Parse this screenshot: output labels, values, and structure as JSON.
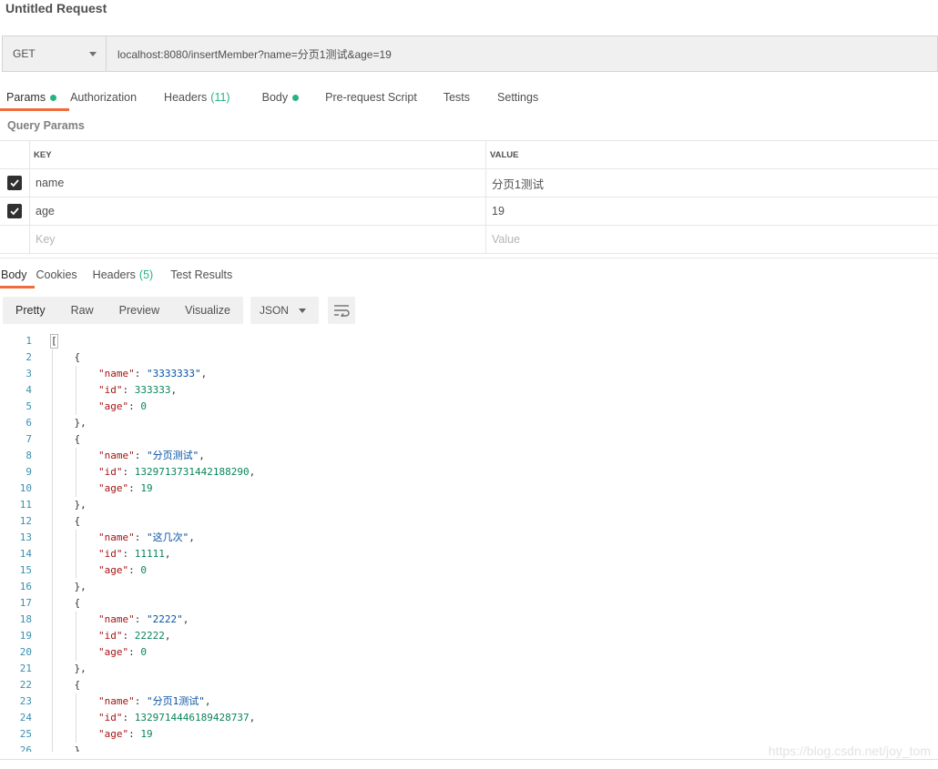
{
  "request": {
    "title": "Untitled Request",
    "method": "GET",
    "url": "localhost:8080/insertMember?name=分页1测试&age=19"
  },
  "request_tabs": [
    {
      "label": "Params",
      "dot": true,
      "active": true
    },
    {
      "label": "Authorization"
    },
    {
      "label": "Headers",
      "count": "(11)"
    },
    {
      "label": "Body",
      "dot": true
    },
    {
      "label": "Pre-request Script"
    },
    {
      "label": "Tests"
    },
    {
      "label": "Settings"
    }
  ],
  "query_params": {
    "title": "Query Params",
    "key_header": "KEY",
    "value_header": "VALUE",
    "rows": [
      {
        "checked": true,
        "key": "name",
        "value": "分页1测试"
      },
      {
        "checked": true,
        "key": "age",
        "value": "19"
      }
    ],
    "key_placeholder": "Key",
    "value_placeholder": "Value"
  },
  "response_tabs": [
    {
      "label": "Body",
      "active": true
    },
    {
      "label": "Cookies"
    },
    {
      "label": "Headers",
      "count": "(5)"
    },
    {
      "label": "Test Results"
    }
  ],
  "view_modes": [
    "Pretty",
    "Raw",
    "Preview",
    "Visualize"
  ],
  "view_mode_selected": "Pretty",
  "format": "JSON",
  "icons": {
    "method_dropdown": "chevron-down-icon",
    "format_dropdown": "chevron-down-icon",
    "wrap": "wrap-lines-icon",
    "checkbox": "checkmark-icon"
  },
  "colors": {
    "accent": "#f26b3a",
    "dot": "#26b47f",
    "key": "#a31515",
    "string": "#0451a5",
    "number": "#098658",
    "line_number": "#3a8fb0"
  },
  "response_lines": [
    {
      "n": "1",
      "t": "["
    },
    {
      "n": "2",
      "t": "    {"
    },
    {
      "n": "3",
      "k": "\"name\"",
      "v": "\"3333333\"",
      "vt": "s",
      "c": ","
    },
    {
      "n": "4",
      "k": "\"id\"",
      "v": "333333",
      "vt": "n",
      "c": ","
    },
    {
      "n": "5",
      "k": "\"age\"",
      "v": "0",
      "vt": "n",
      "c": ""
    },
    {
      "n": "6",
      "t": "    },"
    },
    {
      "n": "7",
      "t": "    {"
    },
    {
      "n": "8",
      "k": "\"name\"",
      "v": "\"分页测试\"",
      "vt": "s",
      "c": ","
    },
    {
      "n": "9",
      "k": "\"id\"",
      "v": "1329713731442188290",
      "vt": "n",
      "c": ","
    },
    {
      "n": "10",
      "k": "\"age\"",
      "v": "19",
      "vt": "n",
      "c": ""
    },
    {
      "n": "11",
      "t": "    },"
    },
    {
      "n": "12",
      "t": "    {"
    },
    {
      "n": "13",
      "k": "\"name\"",
      "v": "\"这几次\"",
      "vt": "s",
      "c": ","
    },
    {
      "n": "14",
      "k": "\"id\"",
      "v": "11111",
      "vt": "n",
      "c": ","
    },
    {
      "n": "15",
      "k": "\"age\"",
      "v": "0",
      "vt": "n",
      "c": ""
    },
    {
      "n": "16",
      "t": "    },"
    },
    {
      "n": "17",
      "t": "    {"
    },
    {
      "n": "18",
      "k": "\"name\"",
      "v": "\"2222\"",
      "vt": "s",
      "c": ","
    },
    {
      "n": "19",
      "k": "\"id\"",
      "v": "22222",
      "vt": "n",
      "c": ","
    },
    {
      "n": "20",
      "k": "\"age\"",
      "v": "0",
      "vt": "n",
      "c": ""
    },
    {
      "n": "21",
      "t": "    },"
    },
    {
      "n": "22",
      "t": "    {"
    },
    {
      "n": "23",
      "k": "\"name\"",
      "v": "\"分页1测试\"",
      "vt": "s",
      "c": ","
    },
    {
      "n": "24",
      "k": "\"id\"",
      "v": "1329714446189428737",
      "vt": "n",
      "c": ","
    },
    {
      "n": "25",
      "k": "\"age\"",
      "v": "19",
      "vt": "n",
      "c": ""
    },
    {
      "n": "26",
      "t": "    }"
    }
  ],
  "watermark": "https://blog.csdn.net/joy_tom"
}
